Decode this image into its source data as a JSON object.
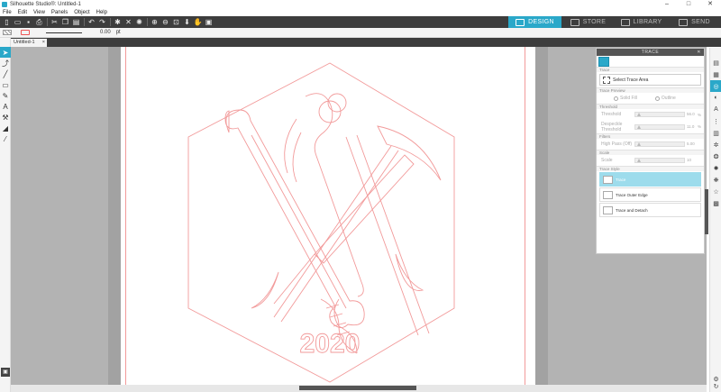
{
  "window": {
    "title": "Silhouette Studio®: Untitled-1",
    "controls": [
      "–",
      "□",
      "✕"
    ]
  },
  "menu": [
    "File",
    "Edit",
    "View",
    "Panels",
    "Object",
    "Help"
  ],
  "tabs": [
    {
      "label": "DESIGN",
      "active": true
    },
    {
      "label": "STORE",
      "active": false
    },
    {
      "label": "LIBRARY",
      "active": false
    },
    {
      "label": "SEND",
      "active": false
    }
  ],
  "line": {
    "width_value": "0.00",
    "unit": "pt"
  },
  "document_tab": {
    "label": "Untitled-1",
    "close": "×"
  },
  "trace_panel": {
    "header": "TRACE",
    "close": "✕",
    "trace_section": "Trace",
    "select_area": "Select Trace Area",
    "preview_section": "Trace Preview",
    "preview_options": [
      "Solid Fill",
      "Outline"
    ],
    "threshold_section": "Threshold",
    "threshold_label": "Threshold",
    "threshold_value": "56.0",
    "threshold_unit": "%",
    "despeckle_label": "Despeckle Threshold",
    "despeckle_value": "11.0",
    "despeckle_unit": "%",
    "filters_section": "Filters",
    "highpass_label": "High Pass (Off)",
    "highpass_value": "5.00",
    "scale_section": "Scale",
    "scale_label": "Scale",
    "scale_value": "10",
    "style_section": "Trace Style",
    "styles": [
      {
        "label": "Trace",
        "selected": true
      },
      {
        "label": "Trace Outer Edge",
        "selected": false
      },
      {
        "label": "Trace and Detach",
        "selected": false
      }
    ]
  },
  "design": {
    "year_text": "2020",
    "stroke_color": "#f29a9a"
  },
  "colors": {
    "accent": "#2aa8c9",
    "toolbar": "#3d3d3d",
    "canvas": "#b3b3b3"
  }
}
